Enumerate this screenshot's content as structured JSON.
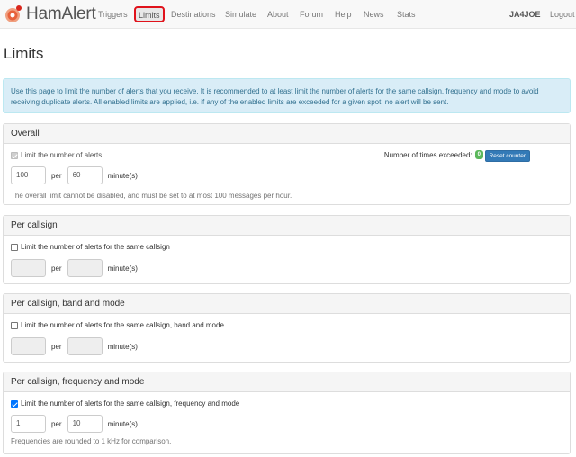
{
  "navbar": {
    "brand": "HamAlert",
    "items": [
      "Triggers",
      "Limits",
      "Destinations",
      "Simulate",
      "About",
      "Forum",
      "Help",
      "News",
      "Stats"
    ],
    "user": "JA4JOE",
    "logout": "Logout"
  },
  "page": {
    "title": "Limits",
    "info": "Use this page to limit the number of alerts that you receive. It is recommended to at least limit the number of alerts for the same callsign, frequency and mode to avoid receiving duplicate alerts. All enabled limits are applied, i.e. if any of the enabled limits are exceeded for a given spot, no alert will be sent."
  },
  "overall": {
    "heading": "Overall",
    "checkbox_label": "Limit the number of alerts",
    "checked": true,
    "count": "100",
    "per": "per",
    "minutes": "60",
    "unit": "minute(s)",
    "exceeded_label": "Number of times exceeded:",
    "exceeded_count": "0",
    "reset_label": "Reset counter",
    "help": "The overall limit cannot be disabled, and must be set to at most 100 messages per hour."
  },
  "per_callsign": {
    "heading": "Per callsign",
    "checkbox_label": "Limit the number of alerts for the same callsign",
    "checked": false,
    "count": "",
    "per": "per",
    "minutes": "",
    "unit": "minute(s)"
  },
  "per_callsign_band_mode": {
    "heading": "Per callsign, band and mode",
    "checkbox_label": "Limit the number of alerts for the same callsign, band and mode",
    "checked": false,
    "count": "",
    "per": "per",
    "minutes": "",
    "unit": "minute(s)"
  },
  "per_callsign_freq_mode": {
    "heading": "Per callsign, frequency and mode",
    "checkbox_label": "Limit the number of alerts for the same callsign, frequency and mode",
    "checked": true,
    "count": "1",
    "per": "per",
    "minutes": "10",
    "unit": "minute(s)",
    "help": "Frequencies are rounded to 1 kHz for comparison."
  },
  "colors": {
    "accent": "#337ab7",
    "highlight": "#e0121b",
    "badge": "#5cb85c"
  }
}
